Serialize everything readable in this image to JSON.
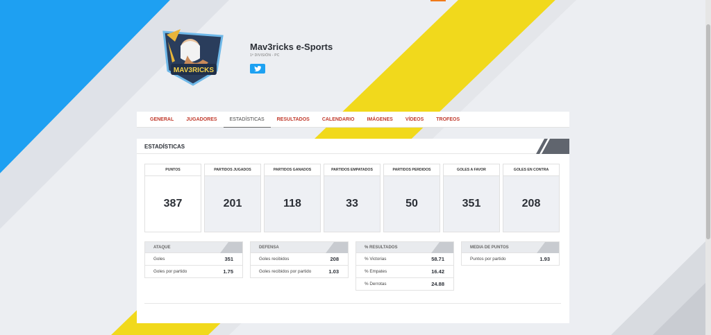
{
  "team": {
    "name": "Mav3ricks e-Sports",
    "subtitle": "1ª DIVISIÓN - PC",
    "logo_text": "MAV3RICKS"
  },
  "tabs": [
    {
      "label": "GENERAL",
      "active": false
    },
    {
      "label": "JUGADORES",
      "active": false
    },
    {
      "label": "ESTADÍSTICAS",
      "active": true
    },
    {
      "label": "RESULTADOS",
      "active": false
    },
    {
      "label": "CALENDARIO",
      "active": false
    },
    {
      "label": "IMÁGENES",
      "active": false
    },
    {
      "label": "VÍDEOS",
      "active": false
    },
    {
      "label": "TROFEOS",
      "active": false
    }
  ],
  "stats": {
    "title": "ESTADÍSTICAS",
    "cards": [
      {
        "label": "PUNTOS",
        "value": "387"
      },
      {
        "label": "PARTIDOS JUGADOS",
        "value": "201"
      },
      {
        "label": "PARTIDOS GANADOS",
        "value": "118"
      },
      {
        "label": "PARTIDOS EMPATADOS",
        "value": "33"
      },
      {
        "label": "PARTIDOS PERDIDOS",
        "value": "50"
      },
      {
        "label": "GOLES A FAVOR",
        "value": "351"
      },
      {
        "label": "GOLES EN CONTRA",
        "value": "208"
      }
    ],
    "tables": [
      {
        "title": "ATAQUE",
        "rows": [
          {
            "label": "Goles",
            "value": "351"
          },
          {
            "label": "Goles por partido",
            "value": "1.75"
          }
        ]
      },
      {
        "title": "DEFENSA",
        "rows": [
          {
            "label": "Goles recibidos",
            "value": "208"
          },
          {
            "label": "Goles recibidos por partido",
            "value": "1.03"
          }
        ]
      },
      {
        "title": "% RESULTADOS",
        "rows": [
          {
            "label": "% Victorias",
            "value": "58.71"
          },
          {
            "label": "% Empates",
            "value": "16.42"
          },
          {
            "label": "% Derrotas",
            "value": "24.88"
          }
        ]
      },
      {
        "title": "MEDIA DE PUNTOS",
        "rows": [
          {
            "label": "Puntos por partido",
            "value": "1.93"
          }
        ]
      }
    ]
  },
  "colors": {
    "stripe_blue": "#1ea0f2",
    "stripe_yellow": "#f1d91c",
    "tab_red": "#c0392b",
    "twitter": "#1da1f2"
  }
}
